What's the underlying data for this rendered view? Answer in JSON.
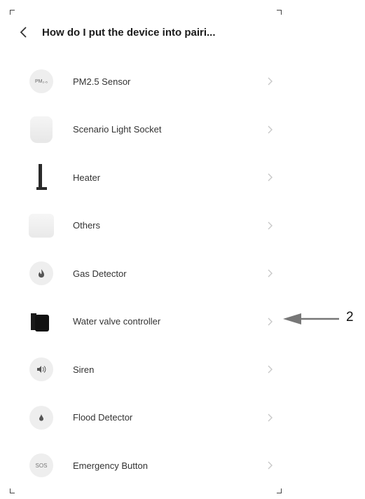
{
  "header": {
    "title": "How do I put the device into pairi..."
  },
  "devices": [
    {
      "label": "PM2.5 Sensor",
      "icon": "pm25-sensor-icon",
      "icon_text": "PM₂.₅"
    },
    {
      "label": "Scenario Light Socket",
      "icon": "light-socket-icon"
    },
    {
      "label": "Heater",
      "icon": "heater-icon"
    },
    {
      "label": "Others",
      "icon": "others-icon"
    },
    {
      "label": "Gas Detector",
      "icon": "gas-detector-icon"
    },
    {
      "label": "Water valve controller",
      "icon": "water-valve-icon"
    },
    {
      "label": "Siren",
      "icon": "siren-icon"
    },
    {
      "label": "Flood Detector",
      "icon": "flood-detector-icon"
    },
    {
      "label": "Emergency Button",
      "icon": "emergency-button-icon",
      "icon_text": "SOS"
    }
  ],
  "annotation": {
    "number": "2",
    "target": "Water valve controller",
    "color": "#777777"
  }
}
